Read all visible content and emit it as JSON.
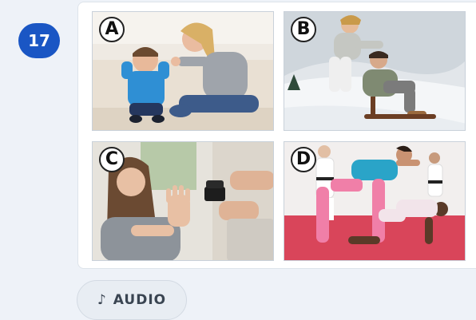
{
  "question": {
    "number": "17"
  },
  "options": [
    {
      "letter": "A"
    },
    {
      "letter": "B"
    },
    {
      "letter": "C"
    },
    {
      "letter": "D"
    }
  ],
  "audio_button": {
    "icon": "♪",
    "label": "AUDIO"
  }
}
